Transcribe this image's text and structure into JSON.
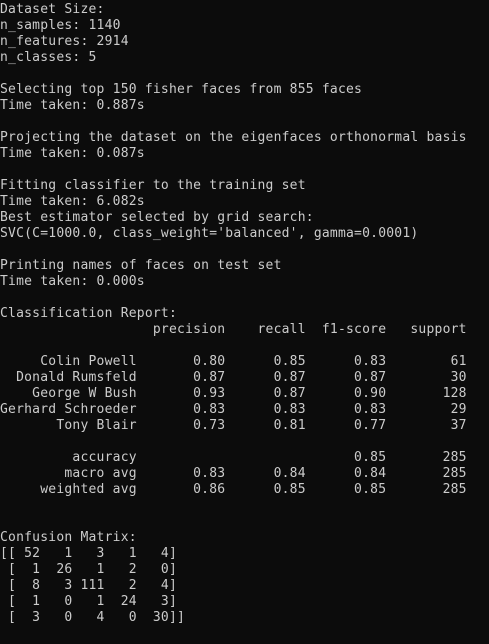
{
  "console": {
    "lines": [
      "Dataset Size:",
      "n_samples: 1140",
      "n_features: 2914",
      "n_classes: 5",
      "",
      "Selecting top 150 fisher faces from 855 faces",
      "Time taken: 0.887s",
      "",
      "Projecting the dataset on the eigenfaces orthonormal basis",
      "Time taken: 0.087s",
      "",
      "Fitting classifier to the training set",
      "Time taken: 6.082s",
      "Best estimator selected by grid search:",
      "SVC(C=1000.0, class_weight='balanced', gamma=0.0001)",
      "",
      "Printing names of faces on test set",
      "Time taken: 0.000s",
      "",
      "Classification Report:",
      "                   precision    recall  f1-score   support",
      "",
      "     Colin Powell       0.80      0.85      0.83        61",
      "  Donald Rumsfeld       0.87      0.87      0.87        30",
      "    George W Bush       0.93      0.87      0.90       128",
      "Gerhard Schroeder       0.83      0.83      0.83        29",
      "       Tony Blair       0.73      0.81      0.77        37",
      "",
      "         accuracy                           0.85       285",
      "        macro avg       0.83      0.84      0.84       285",
      "     weighted avg       0.86      0.85      0.85       285",
      "",
      "",
      "Confusion Matrix:",
      "[[ 52   1   3   1   4]",
      " [  1  26   1   2   0]",
      " [  8   3 111   2   4]",
      " [  1   0   1  24   3]",
      " [  3   0   4   0  30]]"
    ]
  }
}
